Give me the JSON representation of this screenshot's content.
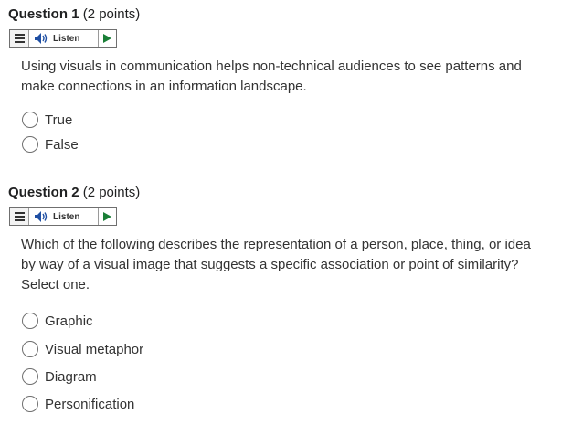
{
  "questions": [
    {
      "title": "Question",
      "number": "1",
      "points": "(2 points)",
      "listen_label": "Listen",
      "prompt_line1": "Using visuals in communication helps non-technical audiences to see patterns and",
      "prompt_line2": "make connections in an information landscape.",
      "options": [
        "True",
        "False"
      ]
    },
    {
      "title": "Question",
      "number": "2",
      "points": "(2 points)",
      "listen_label": "Listen",
      "prompt_line1": "Which of the following describes the representation of a person, place, thing, or idea",
      "prompt_line2": "by way of a visual image that suggests a specific association or point of similarity?",
      "prompt_line3": "Select one.",
      "options": [
        "Graphic",
        "Visual metaphor",
        "Diagram",
        "Personification"
      ]
    }
  ],
  "icons": {
    "menu": "menu-icon",
    "speaker": "speaker-icon",
    "play": "play-icon"
  },
  "colors": {
    "play_green": "#1a7f37",
    "speaker_blue": "#1f4fa3"
  }
}
